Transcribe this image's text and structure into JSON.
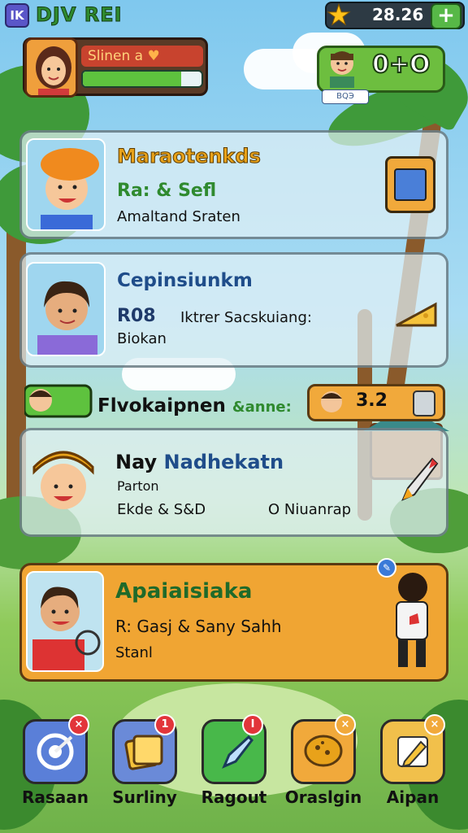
{
  "app": {
    "logo": "IK",
    "title": "DJV REI"
  },
  "currency": {
    "coin_value": "28.26",
    "add_label": "+",
    "icon": "coin-icon"
  },
  "player": {
    "name": "Slinen a",
    "xp_fraction": 0.83
  },
  "friend": {
    "score": "0+O",
    "tag": "ВQЭ"
  },
  "quests": [
    {
      "title": "Maraotenkds",
      "stats": "Ra: & Sefl",
      "desc": "Amaltand Sraten",
      "title_color": "#e8a21a"
    },
    {
      "title": "Cepinsiunkm",
      "stats": "R08",
      "stats_extra": "Iktrer Sacskuiang:",
      "desc": "Biokan",
      "title_color": "#1f4d8a"
    },
    {
      "title": "Nay Nadhekatn",
      "title_a": "Nay ",
      "title_b": "Nadhekatn",
      "sub": "Parton",
      "stats": "Ekde & S&D",
      "extra": "O Niuanrap"
    },
    {
      "title": "Apaiaisiaka",
      "stats": "R: Gasj & Sany Sahh",
      "desc": "Stanl",
      "title_color": "#1f6a2a"
    }
  ],
  "strip": {
    "title": "Flvokaipnen",
    "tag_text": "&anne:",
    "reward_value": "3.2"
  },
  "nav": [
    {
      "label": "Rasaan",
      "color": "#5a7fd8",
      "icon": "target-icon",
      "badge": "×"
    },
    {
      "label": "Surliny",
      "color": "#6a8ad8",
      "icon": "cards-icon",
      "badge": "1"
    },
    {
      "label": "Ragout",
      "color": "#48b84a",
      "icon": "arrow-icon",
      "badge": "I"
    },
    {
      "label": "Oraslgin",
      "color": "#f1a93b",
      "icon": "cookie-icon",
      "badge": "×"
    },
    {
      "label": "Aipan",
      "color": "#f1c04b",
      "icon": "pencil-icon",
      "badge": "×"
    }
  ]
}
